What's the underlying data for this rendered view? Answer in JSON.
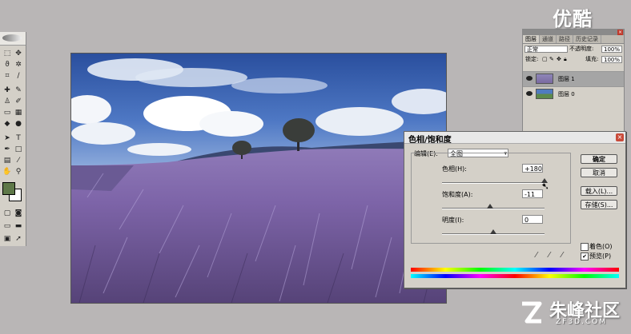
{
  "watermark": {
    "top_right": "优酷",
    "bottom_right": "朱峰社区",
    "bottom_sub": "ZF3D.COM"
  },
  "layers_panel": {
    "tabs": [
      "图层",
      "通道",
      "路径",
      "历史记录"
    ],
    "blend_mode": "正常",
    "opacity_label": "不透明度:",
    "opacity_value": "100%",
    "lock_label": "锁定:",
    "fill_label": "填充:",
    "fill_value": "100%",
    "layers": [
      {
        "name": "图层 1"
      },
      {
        "name": "图层 0"
      }
    ]
  },
  "dialog": {
    "title": "色相/饱和度",
    "edit_label": "编辑(E):",
    "edit_value": "全图",
    "hue_label": "色相(H):",
    "hue_value": "+180",
    "saturation_label": "饱和度(A):",
    "saturation_value": "-11",
    "lightness_label": "明度(I):",
    "lightness_value": "0",
    "buttons": {
      "ok": "确定",
      "cancel": "取消",
      "load": "载入(L)...",
      "save": "存储(S)..."
    },
    "colorize_label": "着色(O)",
    "colorize_checked": false,
    "preview_label": "预览(P)",
    "preview_checked": true,
    "slider_levels": {
      "hue": 1.0,
      "saturation": 0.47,
      "lightness": 0.5
    }
  },
  "toolbox": {
    "foreground_color": "#5e7848",
    "background_color": "#ffffff"
  }
}
